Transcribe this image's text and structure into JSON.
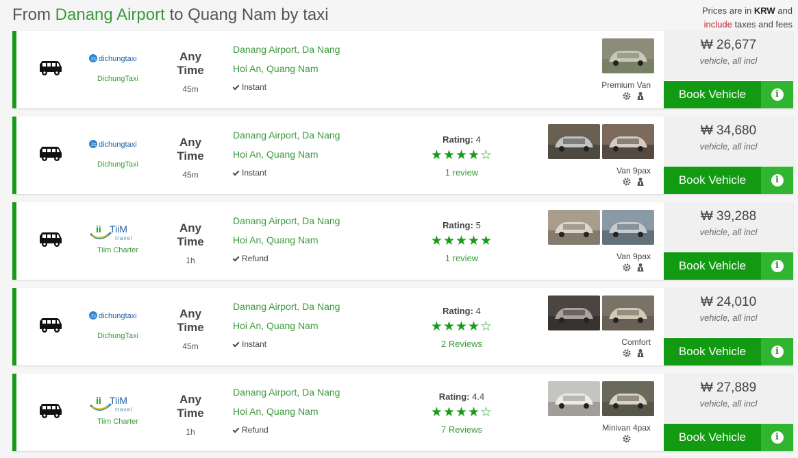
{
  "header": {
    "title_prefix": "From ",
    "title_from": "Danang Airport",
    "title_mid": " to Quang Nam by taxi",
    "note_prefix": "Prices are in ",
    "note_currency": "KRW",
    "note_mid": " and ",
    "note_include": "include",
    "note_suffix": " taxes and fees"
  },
  "labels": {
    "book": "Book Vehicle",
    "rating": "Rating:",
    "info_icon": "i"
  },
  "colors": {
    "accent": "#139a13",
    "info": "#2fb52f",
    "link": "#3a9a3a"
  },
  "results": [
    {
      "provider": "DichungTaxi",
      "logo_text": "dichungtaxi",
      "time": "Any Time",
      "duration": "45m",
      "from": "Danang Airport, Da Nang",
      "to": "Hoi An, Quang Nam",
      "policy": "Instant",
      "rating_value": "",
      "stars": "",
      "reviews": "",
      "vehicle": "Premium Van",
      "price": "₩ 26,677",
      "price_sub": "vehicle, all incl"
    },
    {
      "provider": "DichungTaxi",
      "logo_text": "dichungtaxi",
      "time": "Any Time",
      "duration": "45m",
      "from": "Danang Airport, Da Nang",
      "to": "Hoi An, Quang Nam",
      "policy": "Instant",
      "rating_value": "4",
      "stars": "★★★★☆",
      "reviews": "1 review",
      "vehicle": "Van 9pax",
      "price": "₩ 34,680",
      "price_sub": "vehicle, all incl"
    },
    {
      "provider": "Tiim Charter",
      "logo_text": "TiiM",
      "time": "Any Time",
      "duration": "1h",
      "from": "Danang Airport, Da Nang",
      "to": "Hoi An, Quang Nam",
      "policy": "Refund",
      "rating_value": "5",
      "stars": "★★★★★",
      "reviews": "1 review",
      "vehicle": "Van 9pax",
      "price": "₩ 39,288",
      "price_sub": "vehicle, all incl"
    },
    {
      "provider": "DichungTaxi",
      "logo_text": "dichungtaxi",
      "time": "Any Time",
      "duration": "45m",
      "from": "Danang Airport, Da Nang",
      "to": "Hoi An, Quang Nam",
      "policy": "Instant",
      "rating_value": "4",
      "stars": "★★★★☆",
      "reviews": "2 Reviews",
      "vehicle": "Comfort",
      "price": "₩ 24,010",
      "price_sub": "vehicle, all incl"
    },
    {
      "provider": "Tiim Charter",
      "logo_text": "TiiM",
      "time": "Any Time",
      "duration": "1h",
      "from": "Danang Airport, Da Nang",
      "to": "Hoi An, Quang Nam",
      "policy": "Refund",
      "rating_value": "4.4",
      "stars": "★★★★☆",
      "reviews": "7 Reviews",
      "vehicle": "Minivan 4pax",
      "price": "₩ 27,889",
      "price_sub": "vehicle, all incl"
    }
  ]
}
